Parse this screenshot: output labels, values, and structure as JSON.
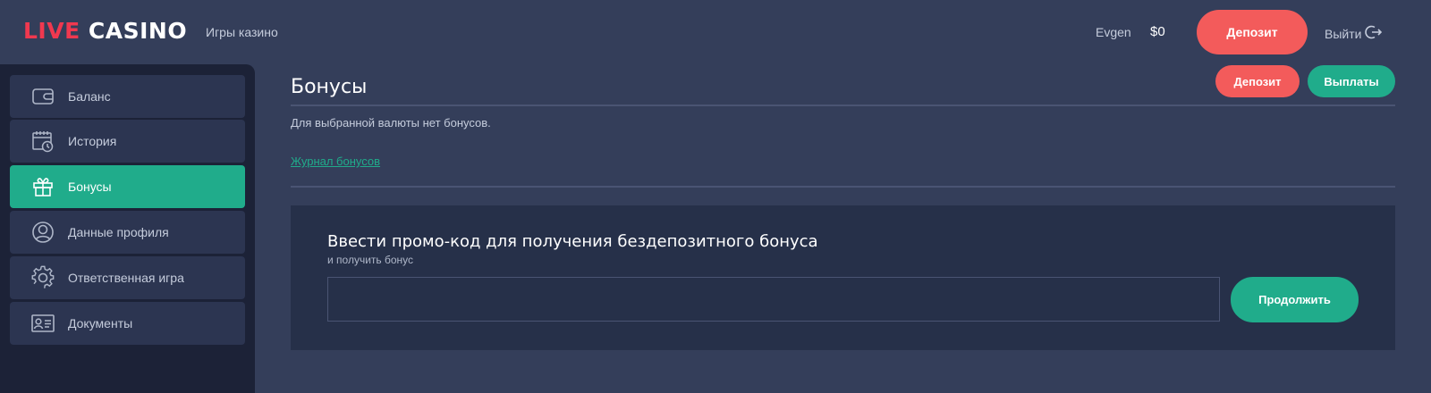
{
  "header": {
    "logo_live": "LIVE",
    "logo_casino": "CASINO",
    "nav_games": "Игры казино",
    "user_name": "Evgen",
    "balance": "$0",
    "deposit_label": "Депозит",
    "logout_label": "Выйти"
  },
  "sidebar": {
    "items": [
      {
        "label": "Баланс",
        "icon": "wallet-icon"
      },
      {
        "label": "История",
        "icon": "calendar-clock-icon"
      },
      {
        "label": "Бонусы",
        "icon": "gift-icon",
        "active": true
      },
      {
        "label": "Данные профиля",
        "icon": "user-circle-icon"
      },
      {
        "label": "Ответственная игра",
        "icon": "gear-icon"
      },
      {
        "label": "Документы",
        "icon": "id-card-icon"
      }
    ]
  },
  "main": {
    "title": "Бонусы",
    "deposit_label": "Депозит",
    "payouts_label": "Выплаты",
    "no_bonus_text": "Для выбранной валюты нет бонусов.",
    "bonus_log_link": "Журнал бонусов",
    "promo": {
      "title": "Ввести промо-код для получения бездепозитного бонуса",
      "subtitle": "и получить бонус",
      "input_value": "",
      "input_placeholder": "",
      "continue_label": "Продолжить"
    }
  },
  "colors": {
    "background": "#343e5a",
    "sidebar_bg": "#1c2237",
    "accent_green": "#20ac8b",
    "accent_red": "#f35b5b",
    "logo_red": "#f0384f"
  }
}
